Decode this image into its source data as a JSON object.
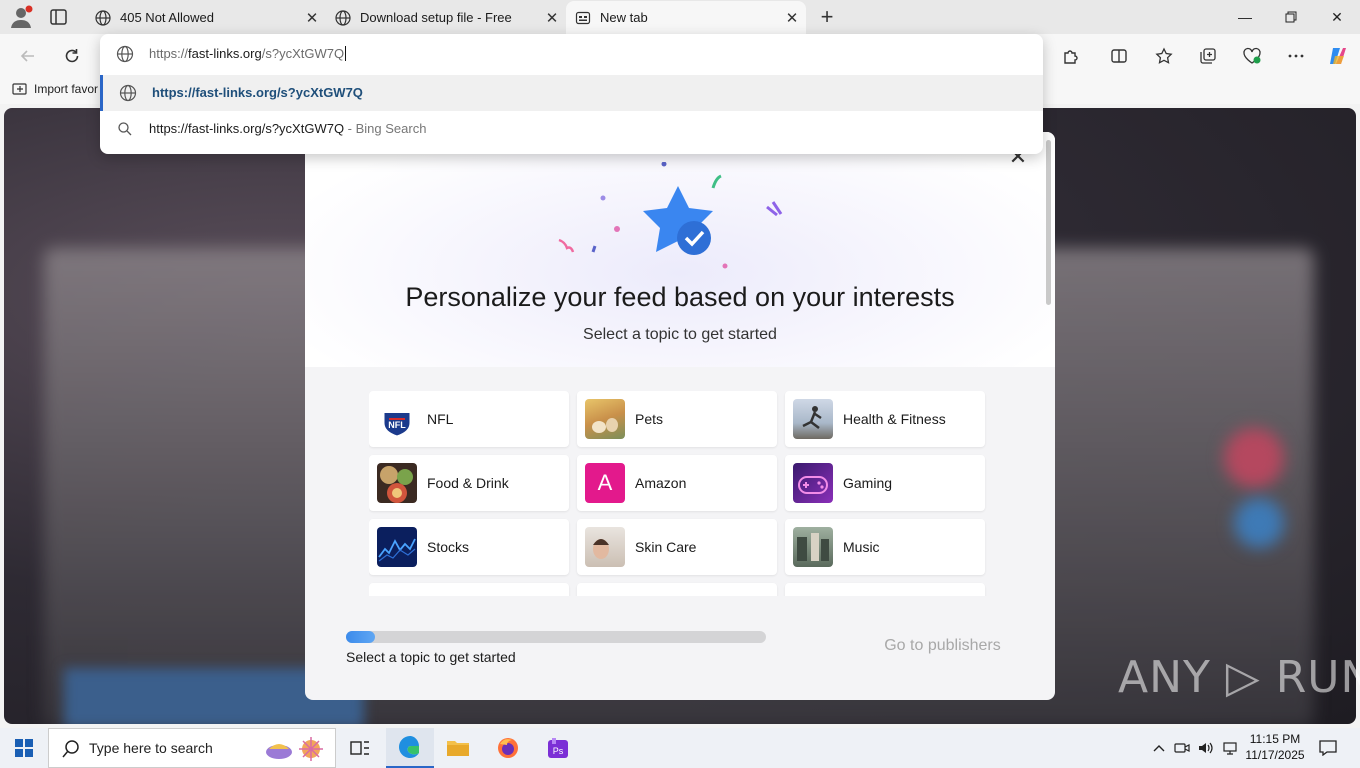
{
  "tabs": [
    {
      "label": "405 Not Allowed",
      "active": false
    },
    {
      "label": "Download setup file - Free",
      "active": false
    },
    {
      "label": "New tab",
      "active": true
    }
  ],
  "favorites": {
    "import_label": "Import favor"
  },
  "address": {
    "prefix": "https://",
    "host": "fast-links.org",
    "path": "/s?ycXtGW7Q"
  },
  "suggestions": [
    {
      "text": "https://fast-links.org/s?ycXtGW7Q",
      "extra": "",
      "icon": "globe-icon",
      "selected": true
    },
    {
      "text": "https://fast-links.org/s?ycXtGW7Q",
      "extra": " - Bing Search",
      "icon": "search-icon",
      "selected": false
    }
  ],
  "modal": {
    "title": "Personalize your feed based on your interests",
    "subtitle": "Select a topic to get started",
    "topics": [
      {
        "label": "NFL",
        "icon": "nfl-logo"
      },
      {
        "label": "Pets",
        "icon": "pets-image"
      },
      {
        "label": "Health & Fitness",
        "icon": "fitness-image"
      },
      {
        "label": "Food & Drink",
        "icon": "food-image"
      },
      {
        "label": "Amazon",
        "icon": "amazon-logo"
      },
      {
        "label": "Gaming",
        "icon": "gaming-image"
      },
      {
        "label": "Stocks",
        "icon": "stocks-image"
      },
      {
        "label": "Skin Care",
        "icon": "skincare-image"
      },
      {
        "label": "Music",
        "icon": "music-image"
      }
    ],
    "progress_fraction": 0.07,
    "progress_label": "Select a topic to get started",
    "go_button": "Go to publishers"
  },
  "amazon_letter": "A",
  "watermark": "ANY ▷ RUN",
  "taskbar": {
    "search_placeholder": "Type here to search",
    "time": "11:15 PM",
    "date": "11/17/2025"
  },
  "colors": {
    "accent": "#2a66c7",
    "progress": "#3b8beb",
    "amazon_tile": "#e3198c"
  }
}
